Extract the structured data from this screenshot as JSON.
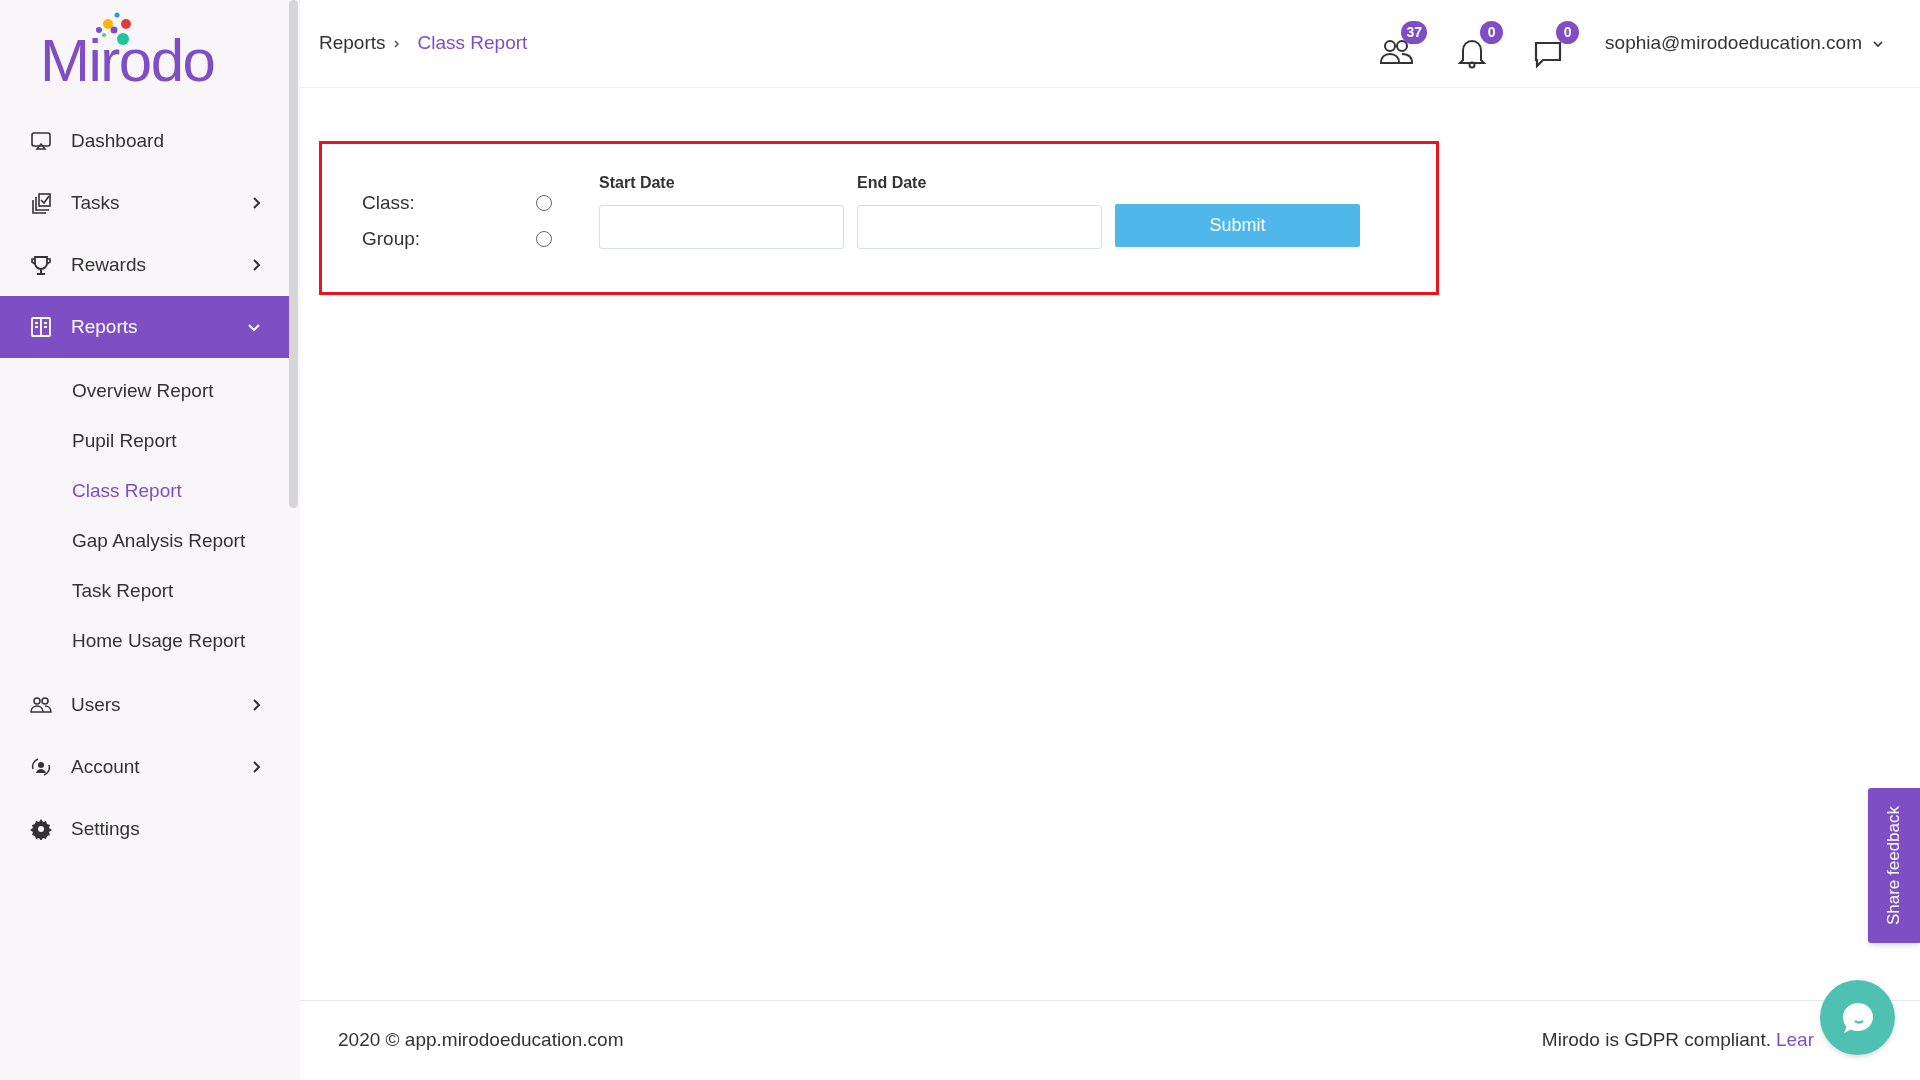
{
  "logo": {
    "text": "Mirodo"
  },
  "sidebar": {
    "items": [
      {
        "label": "Dashboard",
        "kind": "monitor",
        "selected": false
      },
      {
        "label": "Tasks",
        "kind": "tasks",
        "expanded": false,
        "selected": false
      },
      {
        "label": "Rewards",
        "kind": "trophy",
        "expanded": false,
        "selected": false
      },
      {
        "label": "Reports",
        "kind": "reports",
        "expanded": true,
        "selected": true,
        "children": [
          {
            "label": "Overview Report",
            "selected": false
          },
          {
            "label": "Pupil Report",
            "selected": false
          },
          {
            "label": "Class Report",
            "selected": true
          },
          {
            "label": "Gap Analysis Report",
            "selected": false
          },
          {
            "label": "Task Report",
            "selected": false
          },
          {
            "label": "Home Usage Report",
            "selected": false
          }
        ]
      },
      {
        "label": "Users",
        "kind": "users",
        "expanded": false,
        "selected": false
      },
      {
        "label": "Account",
        "kind": "account",
        "expanded": false,
        "selected": false
      },
      {
        "label": "Settings",
        "kind": "gear",
        "selected": false
      }
    ]
  },
  "breadcrumb": [
    {
      "label": "Reports",
      "current": false
    },
    {
      "label": "Class Report",
      "current": true
    }
  ],
  "header": {
    "icons": [
      {
        "kind": "users",
        "badge": "37"
      },
      {
        "kind": "bell",
        "badge": "0"
      },
      {
        "kind": "chat",
        "badge": "0"
      }
    ],
    "user": "sophia@mirodoeducation.com"
  },
  "form": {
    "options": [
      {
        "label": "Class:",
        "selected": false
      },
      {
        "label": "Group:",
        "selected": false
      }
    ],
    "fields": [
      {
        "label": "Start Date"
      },
      {
        "label": "End Date"
      }
    ],
    "submit": "Submit"
  },
  "footer": {
    "copyright": "2020 © app.mirodoeducation.com",
    "notice": "Mirodo is GDPR compliant.",
    "link": "Lear"
  },
  "feedback_tab": "Share feedback"
}
